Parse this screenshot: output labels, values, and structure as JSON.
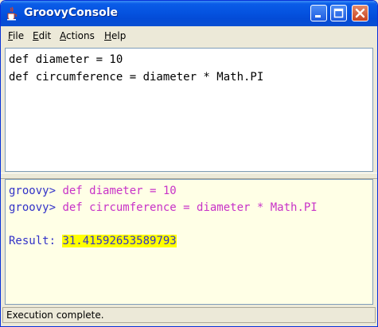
{
  "window": {
    "title": "GroovyConsole",
    "app_icon": "java-cup-icon",
    "controls": [
      "minimize-icon",
      "maximize-icon",
      "close-icon"
    ]
  },
  "menu": {
    "items": [
      {
        "label": "File"
      },
      {
        "label": "Edit"
      },
      {
        "label": "Actions"
      },
      {
        "label": "Help"
      }
    ]
  },
  "editor": {
    "lines": [
      "def diameter = 10",
      "def circumference = diameter * Math.PI"
    ]
  },
  "output": {
    "lines": [
      {
        "prompt": "groovy> ",
        "code": "def diameter = 10"
      },
      {
        "prompt": "groovy> ",
        "code": "def circumference = diameter * Math.PI"
      }
    ],
    "result_label": "Result: ",
    "result_value": "31.41592653589793"
  },
  "status": {
    "text": "Execution complete."
  },
  "colors": {
    "titlebar": "#0553e0",
    "prompt": "#3232c8",
    "echo": "#c832c8",
    "result_highlight": "#ffff00",
    "output_background": "#ffffe6"
  }
}
